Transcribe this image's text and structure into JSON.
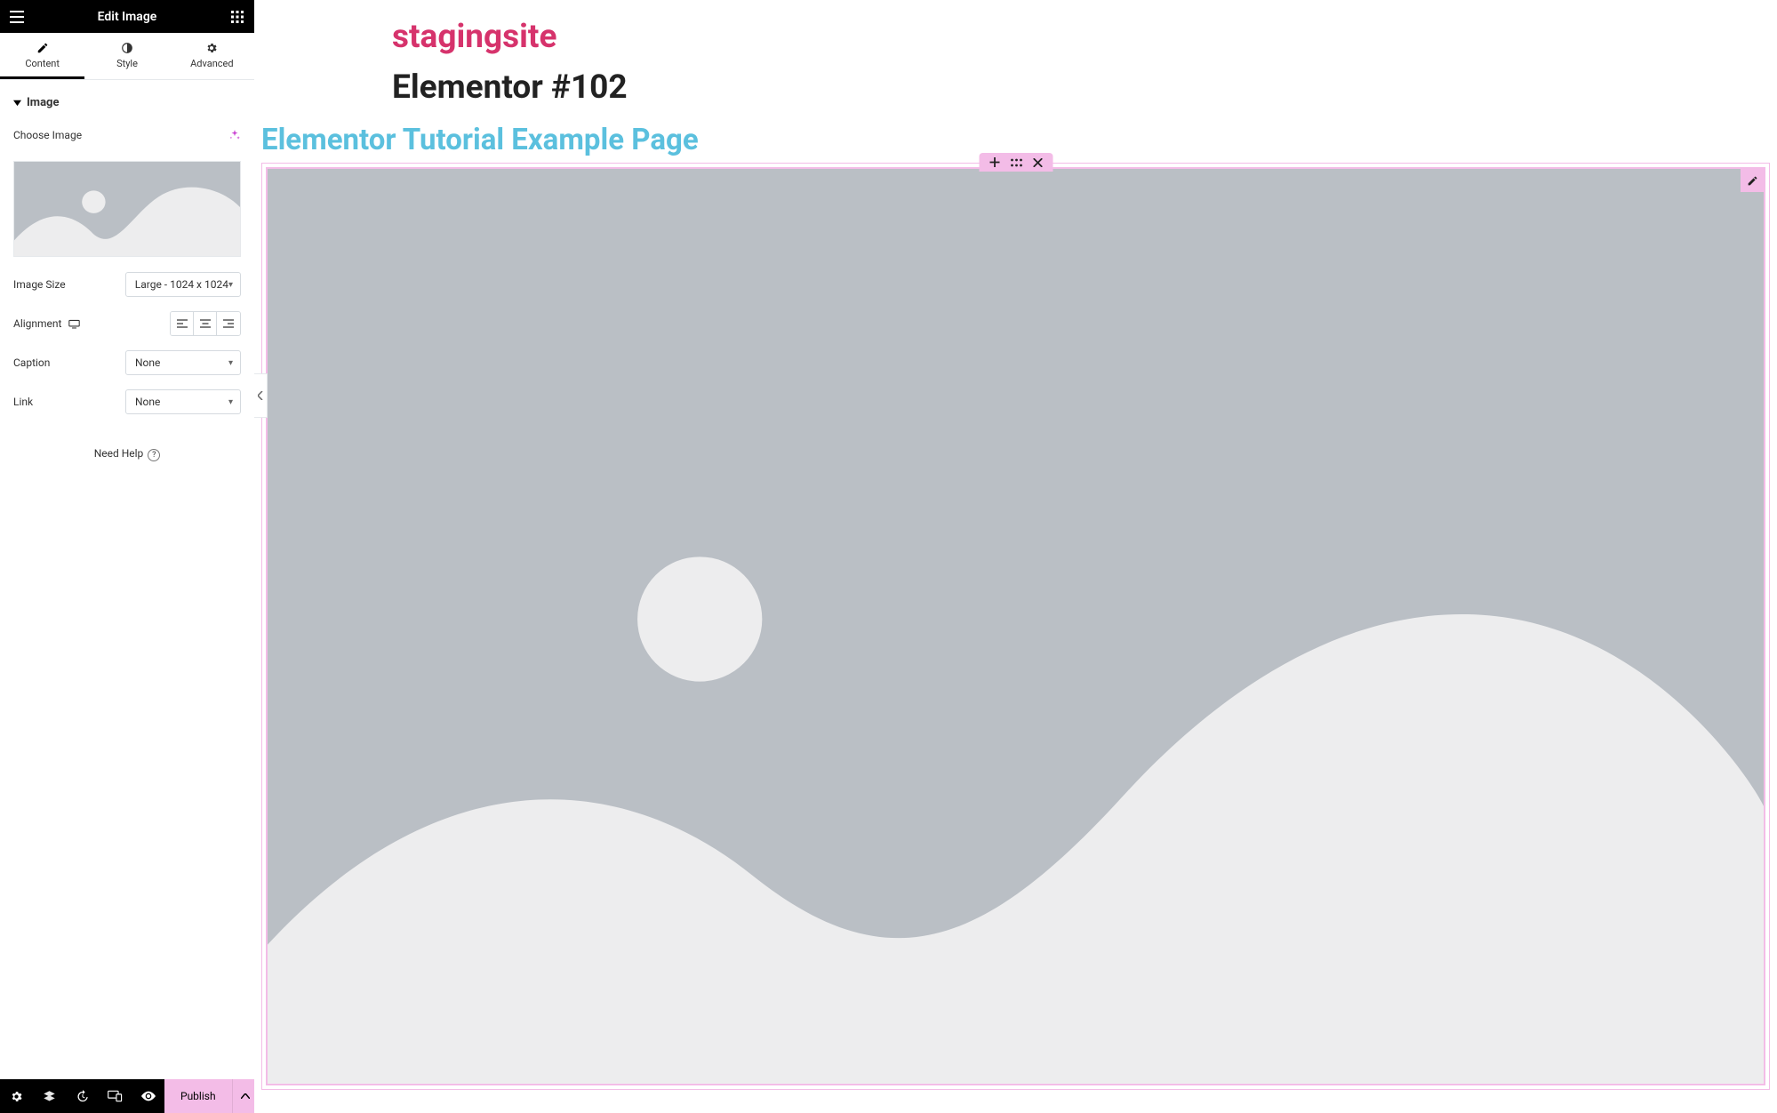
{
  "sidebar": {
    "header_title": "Edit Image",
    "tabs": {
      "content": "Content",
      "style": "Style",
      "advanced": "Advanced"
    },
    "section_title": "Image",
    "choose_image_label": "Choose Image",
    "image_size_label": "Image Size",
    "image_size_value": "Large - 1024 x 1024",
    "alignment_label": "Alignment",
    "caption_label": "Caption",
    "caption_value": "None",
    "link_label": "Link",
    "link_value": "None",
    "help_label": "Need Help"
  },
  "footer": {
    "publish_label": "Publish"
  },
  "page": {
    "site_title": "stagingsite",
    "page_title": "Elementor #102",
    "tutorial_title": "Elementor Tutorial Example Page"
  }
}
